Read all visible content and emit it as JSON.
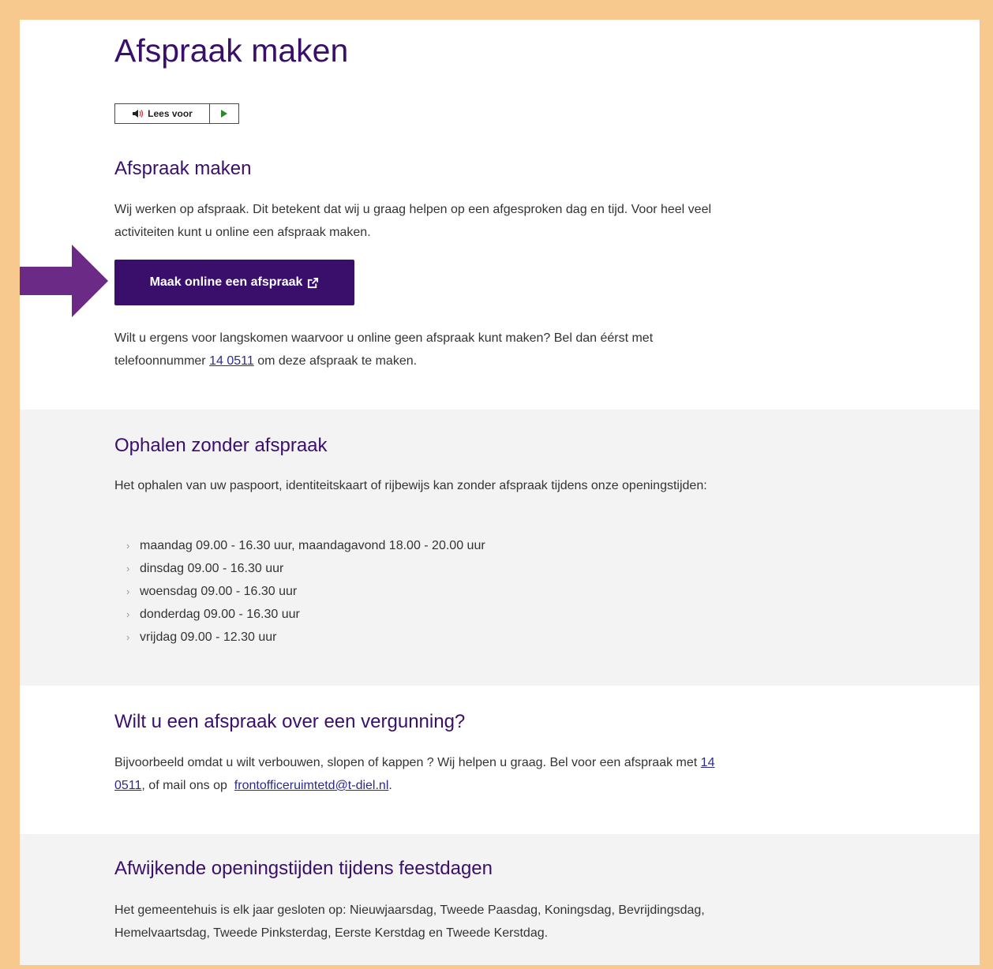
{
  "page": {
    "title": "Afspraak maken"
  },
  "readspeaker": {
    "label": "Lees voor",
    "speaker_icon": "speaker-icon",
    "play_icon": "play-icon"
  },
  "section1": {
    "heading": "Afspraak maken",
    "paragraph": "Wij werken op afspraak. Dit betekent dat wij u graag helpen op een afgesproken dag en tijd. Voor heel veel activiteiten kunt u online een afspraak maken.",
    "button_label": "Maak online een afspraak",
    "button_icon": "external-link-icon",
    "phone_text_before": "Wilt u ergens voor langskomen waarvoor u online geen afspraak kunt maken? Bel dan éérst met telefoonnummer",
    "phone_link": "14 0511",
    "phone_text_after": "om deze afspraak te maken."
  },
  "section2": {
    "heading": "Ophalen zonder afspraak",
    "paragraph": "Het ophalen van uw paspoort, identiteitskaart of rijbewijs kan zonder afspraak tijdens onze openingstijden:",
    "hours": [
      "maandag 09.00 - 16.30 uur, maandagavond 18.00 - 20.00 uur",
      "dinsdag 09.00 - 16.30 uur",
      "woensdag 09.00 - 16.30 uur",
      "donderdag 09.00 - 16.30 uur",
      "vrijdag 09.00 - 12.30 uur"
    ]
  },
  "section3": {
    "heading": "Wilt u een afspraak over een vergunning?",
    "text_before": "Bijvoorbeeld omdat u wilt verbouwen, slopen of kappen ? Wij helpen u graag. Bel voor een afspraak met",
    "phone_link": "14 0511",
    "text_middle": ", of mail ons op",
    "email_link": "frontofficeruimtetd@t-diel.nl",
    "text_after": "."
  },
  "section4": {
    "heading": "Afwijkende openingstijden tijdens feestdagen",
    "paragraph": "Het gemeentehuis is elk jaar gesloten op: Nieuwjaarsdag, Tweede Paasdag, Koningsdag, Bevrijdingsdag, Hemelvaartsdag, Tweede Pinksterdag, Eerste Kerstdag en Tweede Kerstdag."
  },
  "colors": {
    "frame": "#f7c98e",
    "brand": "#3a0f6b",
    "band": "#f3f3f3",
    "arrow": "#6b2a86"
  }
}
